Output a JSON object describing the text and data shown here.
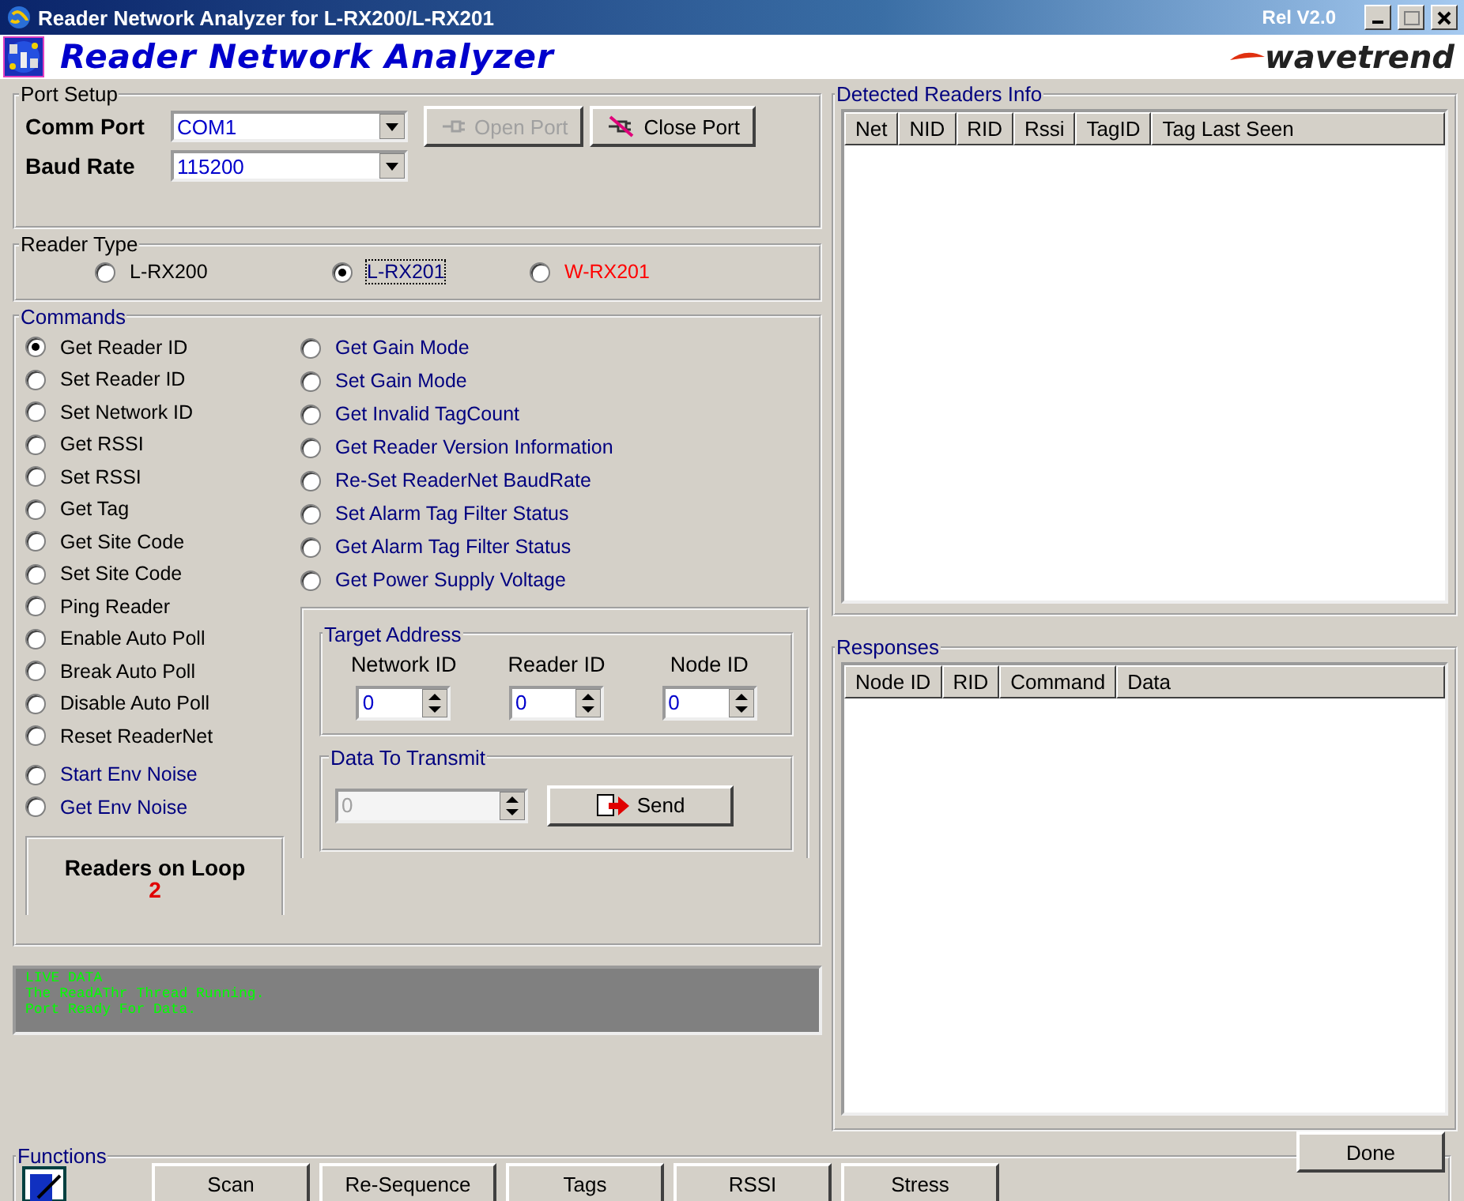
{
  "window": {
    "title": "Reader Network Analyzer for L-RX200/L-RX201",
    "release": "Rel V2.0"
  },
  "header": {
    "app_name": "Reader Network Analyzer",
    "brand": "wavetrend"
  },
  "port_setup": {
    "title": "Port Setup",
    "comm_port": {
      "label": "Comm Port",
      "value": "COM1"
    },
    "baud_rate": {
      "label": "Baud Rate",
      "value": "115200"
    },
    "buttons": [
      {
        "label": "Open Port",
        "disabled": true,
        "kind": "open"
      },
      {
        "label": "Close Port",
        "disabled": false,
        "kind": "close"
      }
    ]
  },
  "reader_type": {
    "title": "Reader Type",
    "options": [
      {
        "label": "L-RX200",
        "selected": false,
        "color": "#000000"
      },
      {
        "label": "L-RX201",
        "selected": true,
        "color": "#000080"
      },
      {
        "label": "W-RX201",
        "selected": false,
        "color": "#ff0000"
      }
    ]
  },
  "commands": {
    "title": "Commands",
    "basic": [
      {
        "label": "Get Reader ID",
        "selected": true
      },
      {
        "label": "Set Reader ID",
        "selected": false
      },
      {
        "label": "Set Network ID",
        "selected": false
      },
      {
        "label": "Get RSSI",
        "selected": false
      },
      {
        "label": "Set RSSI",
        "selected": false
      },
      {
        "label": "Get Tag",
        "selected": false
      },
      {
        "label": "Get Site Code",
        "selected": false
      },
      {
        "label": "Set Site Code",
        "selected": false
      },
      {
        "label": "Ping Reader",
        "selected": false
      },
      {
        "label": "Enable Auto Poll",
        "selected": false
      },
      {
        "label": "Break Auto Poll",
        "selected": false
      },
      {
        "label": "Disable Auto Poll",
        "selected": false
      },
      {
        "label": "Reset ReaderNet",
        "selected": false
      }
    ],
    "noise": [
      {
        "label": "Start Env Noise",
        "selected": false
      },
      {
        "label": "Get Env Noise",
        "selected": false
      }
    ],
    "advanced": [
      {
        "label": "Get Gain Mode",
        "selected": false
      },
      {
        "label": "Set Gain Mode",
        "selected": false
      },
      {
        "label": "Get Invalid TagCount",
        "selected": false
      },
      {
        "label": "Get Reader Version Information",
        "selected": false
      },
      {
        "label": "Re-Set ReaderNet BaudRate",
        "selected": false
      },
      {
        "label": "Set Alarm Tag Filter Status",
        "selected": false
      },
      {
        "label": "Get Alarm Tag Filter Status",
        "selected": false
      },
      {
        "label": "Get Power Supply Voltage",
        "selected": false
      }
    ],
    "readers_on_loop": {
      "label": "Readers on Loop",
      "count": "2"
    },
    "target_address": {
      "title": "Target Address",
      "fields": [
        {
          "label": "Network ID",
          "value": "0"
        },
        {
          "label": "Reader ID",
          "value": "0"
        },
        {
          "label": "Node ID",
          "value": "0"
        }
      ]
    },
    "data_to_transmit": {
      "title": "Data To Transmit",
      "value": "0",
      "disabled": true,
      "send": "Send"
    }
  },
  "live_data": [
    "LIVE DATA",
    "The ReadAThr Thread Running.",
    "Port Ready For Data."
  ],
  "detected_readers": {
    "title": "Detected Readers Info",
    "columns": [
      "Net",
      "NID",
      "RID",
      "Rssi",
      "TagID",
      "Tag Last Seen"
    ]
  },
  "responses": {
    "title": "Responses",
    "columns": [
      "Node ID",
      "RID",
      "Command",
      "Data"
    ]
  },
  "functions": {
    "title": "Functions",
    "buttons": [
      "Scan",
      "Re-Sequence",
      "Tags",
      "RSSI",
      "Stress"
    ],
    "done": "Done"
  }
}
